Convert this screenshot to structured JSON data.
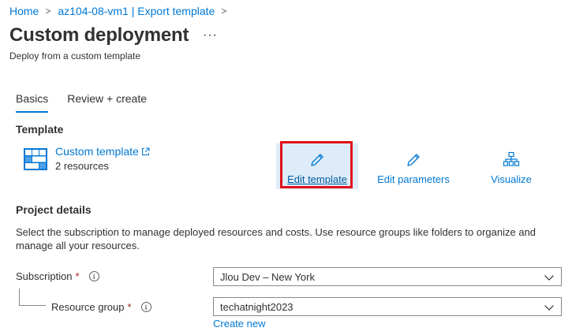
{
  "breadcrumb": {
    "items": [
      "Home",
      "az104-08-vm1 | Export template"
    ],
    "separator": ">"
  },
  "page": {
    "title": "Custom deployment",
    "more": "···",
    "subtitle": "Deploy from a custom template"
  },
  "tabs": [
    {
      "label": "Basics",
      "active": true
    },
    {
      "label": "Review + create",
      "active": false
    }
  ],
  "template_section": {
    "heading": "Template",
    "name": "Custom template",
    "resource_count": "2 resources",
    "icon": "template-grid-icon"
  },
  "actions": {
    "edit_template": {
      "label": "Edit template",
      "icon": "pencil-icon"
    },
    "edit_parameters": {
      "label": "Edit parameters",
      "icon": "pencil-icon"
    },
    "visualize": {
      "label": "Visualize",
      "icon": "hierarchy-icon"
    }
  },
  "project_details": {
    "heading": "Project details",
    "description": "Select the subscription to manage deployed resources and costs. Use resource groups like folders to organize and manage all your resources."
  },
  "fields": {
    "subscription": {
      "label": "Subscription",
      "required": "*",
      "value": "Jlou Dev – New York"
    },
    "resource_group": {
      "label": "Resource group",
      "required": "*",
      "value": "techatnight2023",
      "create_new": "Create new"
    }
  },
  "colors": {
    "link": "#0078d4",
    "highlight": "#e0121b",
    "selected_bg": "#deecf9",
    "required": "#a4262c"
  }
}
